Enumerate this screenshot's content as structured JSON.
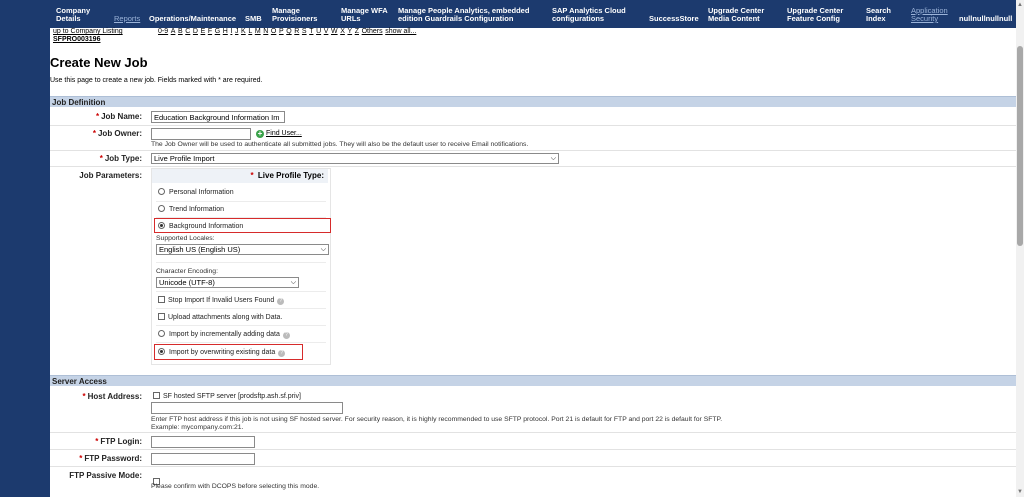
{
  "nav": {
    "items": [
      {
        "label1": "Company",
        "label2": "Details"
      },
      {
        "label1": "Reports",
        "label2": ""
      },
      {
        "label1": "Operations/Maintenance",
        "label2": ""
      },
      {
        "label1": "SMB",
        "label2": ""
      },
      {
        "label1": "Manage",
        "label2": "Provisioners"
      },
      {
        "label1": "Manage WFA",
        "label2": "URLs"
      },
      {
        "label1": "Manage People Analytics, embedded",
        "label2": "edition Guardrails Configuration"
      },
      {
        "label1": "SAP Analytics Cloud",
        "label2": "configurations"
      },
      {
        "label1": "SuccessStore",
        "label2": ""
      },
      {
        "label1": "Upgrade Center",
        "label2": "Media Content"
      },
      {
        "label1": "Upgrade Center",
        "label2": "Feature Config"
      },
      {
        "label1": "Search",
        "label2": "Index"
      },
      {
        "label1": "Application",
        "label2": "Security"
      },
      {
        "label1": "nullnullnullnull",
        "label2": ""
      }
    ]
  },
  "breadcrumb": {
    "up_to": "up to Company Listing",
    "company_id": "SFPRO003196"
  },
  "alphabet": [
    "0-9",
    "A",
    "B",
    "C",
    "D",
    "E",
    "F",
    "G",
    "H",
    "I",
    "J",
    "K",
    "L",
    "M",
    "N",
    "O",
    "P",
    "Q",
    "R",
    "S",
    "T",
    "U",
    "V",
    "W",
    "X",
    "Y",
    "Z",
    "Others",
    "show all..."
  ],
  "page": {
    "title": "Create New Job",
    "description": "Use this page to create a new job. Fields marked with * are required."
  },
  "job_definition": {
    "section_title": "Job Definition",
    "job_name_label": "Job Name:",
    "job_name_value": "Education Background Information Im",
    "job_owner_label": "Job Owner:",
    "job_owner_value": "",
    "find_user": "Find User...",
    "owner_note": "The Job Owner will be used to authenticate all submitted jobs. They will also be the default user to receive Email notifications.",
    "job_type_label": "Job Type:",
    "job_type_value": "Live Profile Import",
    "job_params_label": "Job Parameters:",
    "params": {
      "header": "Live Profile Type:",
      "personal": "Personal Information",
      "trend": "Trend Information",
      "background": "Background Information",
      "supported_locales_label": "Supported Locales:",
      "supported_locales_value": "English US (English US)",
      "encoding_label": "Character Encoding:",
      "encoding_value": "Unicode (UTF-8)",
      "stop_import": "Stop Import If Invalid Users Found",
      "upload_attachments": "Upload attachments along with Data.",
      "incremental": "Import by incrementally adding data",
      "overwrite": "Import by overwriting existing data"
    }
  },
  "server_access": {
    "section_title": "Server Access",
    "host_label": "Host Address:",
    "sf_hosted": "SF hosted SFTP server [prodsftp.ash.sf.priv]",
    "host_value": "",
    "host_note1": "Enter FTP host address if this job is not using SF hosted server. For security reason, it is highly recommended to use SFTP protocol. Port 21 is default for FTP and port 22 is default for SFTP.",
    "host_note2": "Example: mycompany.com:21.",
    "ftp_login_label": "FTP Login:",
    "ftp_password_label": "FTP Password:",
    "ftp_passive_label": "FTP Passive Mode:",
    "passive_note": "Please confirm with DCOPS before selecting this mode."
  },
  "colors": {
    "nav_bg": "#1c3a6e",
    "section_bg": "#c5d3e6",
    "highlight": "#d62b2b",
    "required": "#cc0000"
  }
}
